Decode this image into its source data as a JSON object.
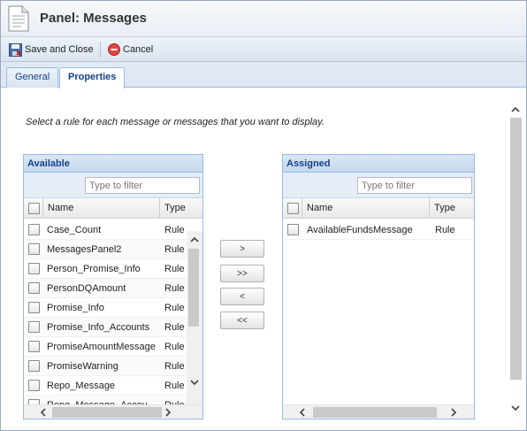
{
  "header": {
    "title": "Panel: Messages"
  },
  "toolbar": {
    "save_close_label": "Save and Close",
    "cancel_label": "Cancel"
  },
  "tabs": [
    {
      "label": "General",
      "active": false
    },
    {
      "label": "Properties",
      "active": true
    }
  ],
  "content": {
    "instruction": "Select a rule for each message or messages that you want to display."
  },
  "available": {
    "title": "Available",
    "filter_placeholder": "Type to filter",
    "columns": {
      "name": "Name",
      "type": "Type"
    },
    "rows": [
      {
        "name": "Case_Count",
        "type": "Rule"
      },
      {
        "name": "MessagesPanel2",
        "type": "Rule"
      },
      {
        "name": "Person_Promise_Info",
        "type": "Rule"
      },
      {
        "name": "PersonDQAmount",
        "type": "Rule"
      },
      {
        "name": "Promise_Info",
        "type": "Rule"
      },
      {
        "name": "Promise_Info_Accounts",
        "type": "Rule"
      },
      {
        "name": "PromiseAmountMessage",
        "type": "Rule"
      },
      {
        "name": "PromiseWarning",
        "type": "Rule"
      },
      {
        "name": "Repo_Message",
        "type": "Rule"
      },
      {
        "name": "Repo_Message_Accou",
        "type": "Rule"
      }
    ]
  },
  "assigned": {
    "title": "Assigned",
    "filter_placeholder": "Type to filter",
    "columns": {
      "name": "Name",
      "type": "Type"
    },
    "rows": [
      {
        "name": "AvailableFundsMessage",
        "type": "Rule"
      }
    ]
  },
  "move_buttons": {
    "add": ">",
    "add_all": ">>",
    "remove": "<",
    "remove_all": "<<"
  }
}
